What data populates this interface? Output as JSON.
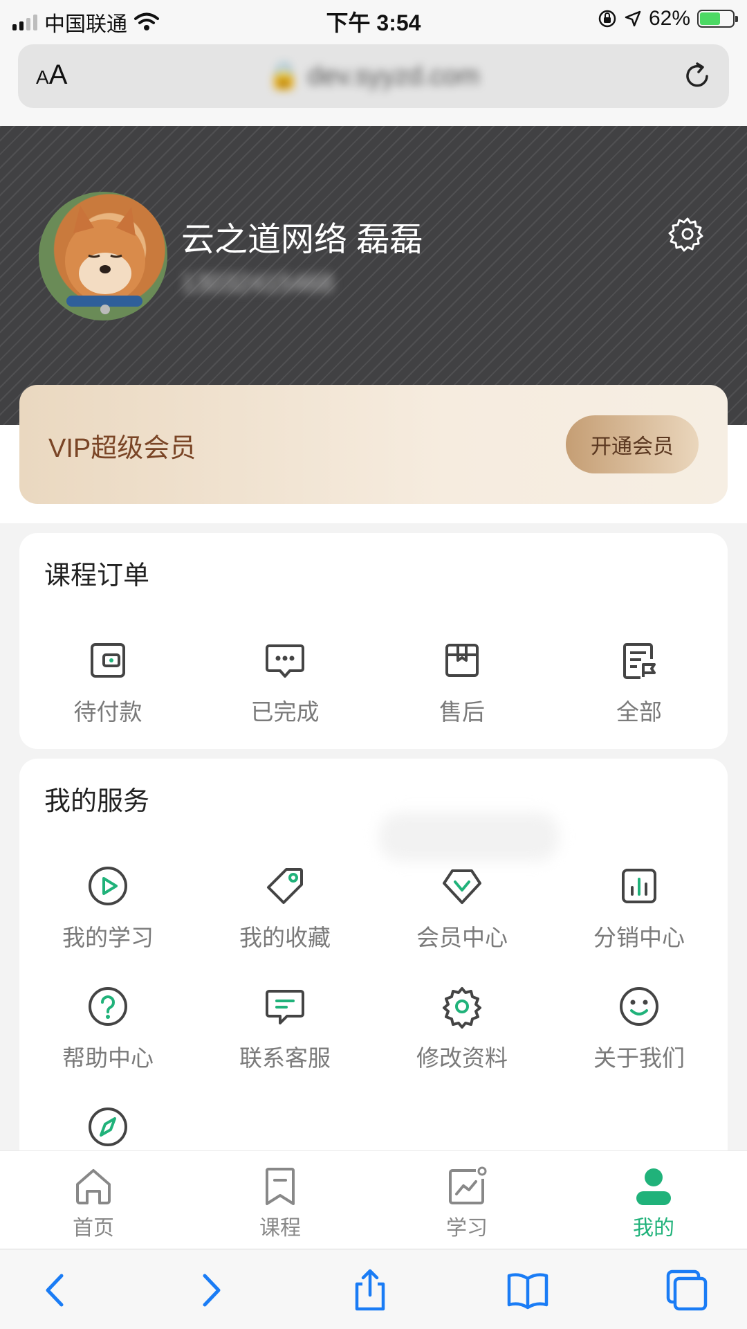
{
  "status_bar": {
    "carrier": "中国联通",
    "time": "下午 3:54",
    "battery": "62%"
  },
  "browser": {
    "font_size_label": "AA",
    "url": "dev.syyzd.com"
  },
  "profile": {
    "name": "云之道网络 磊磊",
    "phone": "13032415468"
  },
  "vip": {
    "title": "VIP超级会员",
    "button": "开通会员"
  },
  "orders": {
    "title": "课程订单",
    "items": [
      {
        "label": "待付款",
        "icon": "wallet-icon"
      },
      {
        "label": "已完成",
        "icon": "chat-dots-icon"
      },
      {
        "label": "售后",
        "icon": "box-icon"
      },
      {
        "label": "全部",
        "icon": "document-list-icon"
      }
    ]
  },
  "services": {
    "title": "我的服务",
    "items": [
      {
        "label": "我的学习",
        "icon": "play-circle-icon"
      },
      {
        "label": "我的收藏",
        "icon": "tag-icon"
      },
      {
        "label": "会员中心",
        "icon": "vip-diamond-icon"
      },
      {
        "label": "分销中心",
        "icon": "bar-chart-icon"
      },
      {
        "label": "帮助中心",
        "icon": "help-circle-icon"
      },
      {
        "label": "联系客服",
        "icon": "message-icon"
      },
      {
        "label": "修改资料",
        "icon": "gear-icon"
      },
      {
        "label": "关于我们",
        "icon": "smile-icon"
      },
      {
        "label": "",
        "icon": "compass-icon"
      }
    ]
  },
  "tabs": [
    {
      "label": "首页",
      "icon": "home-icon",
      "active": false
    },
    {
      "label": "课程",
      "icon": "bookmark-icon",
      "active": false
    },
    {
      "label": "学习",
      "icon": "chart-icon",
      "active": false
    },
    {
      "label": "我的",
      "icon": "user-icon",
      "active": true
    }
  ],
  "colors": {
    "accent": "#20b27a",
    "header_bg": "#414143",
    "vip_text": "#7a4526",
    "icon_dark": "#444444"
  }
}
